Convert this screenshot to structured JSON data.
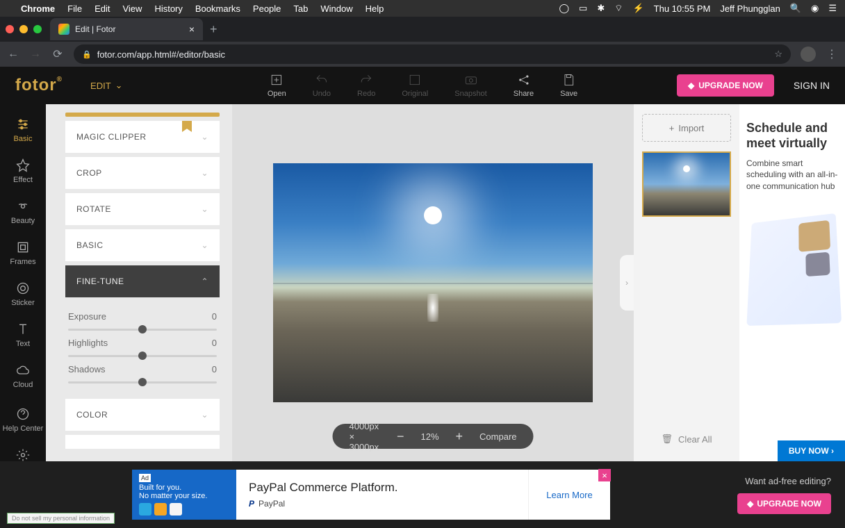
{
  "menubar": {
    "apple": "",
    "items": [
      "Chrome",
      "File",
      "Edit",
      "View",
      "History",
      "Bookmarks",
      "People",
      "Tab",
      "Window",
      "Help"
    ],
    "clock": "Thu 10:55 PM",
    "user": "Jeff Phungglan"
  },
  "browser": {
    "tab_title": "Edit | Fotor",
    "url": "fotor.com/app.html#/editor/basic"
  },
  "appbar": {
    "logo": "fotor",
    "edit_label": "EDIT",
    "tools": {
      "open": "Open",
      "undo": "Undo",
      "redo": "Redo",
      "original": "Original",
      "snapshot": "Snapshot",
      "share": "Share",
      "save": "Save"
    },
    "upgrade": "UPGRADE NOW",
    "signin": "SIGN IN"
  },
  "toolstrip": {
    "basic": "Basic",
    "effect": "Effect",
    "beauty": "Beauty",
    "frames": "Frames",
    "sticker": "Sticker",
    "text": "Text",
    "cloud": "Cloud",
    "help": "Help Center",
    "settings": "Settings"
  },
  "panel": {
    "magic_clipper": "MAGIC CLIPPER",
    "crop": "CROP",
    "rotate": "ROTATE",
    "basic": "BASIC",
    "finetune": "FINE-TUNE",
    "color": "COLOR",
    "sliders": {
      "exposure": {
        "label": "Exposure",
        "value": "0"
      },
      "highlights": {
        "label": "Highlights",
        "value": "0"
      },
      "shadows": {
        "label": "Shadows",
        "value": "0"
      }
    }
  },
  "canvas": {
    "dimensions": "4000px × 3000px",
    "zoom": "12%",
    "compare": "Compare"
  },
  "thumbs": {
    "import": "Import",
    "clear_all": "Clear All"
  },
  "ad_right": {
    "title": "Schedule and meet virtually",
    "body": "Combine smart scheduling with an all-in-one communication hub",
    "cta": "BUY NOW"
  },
  "ad_bottom": {
    "tag": "Ad",
    "line1": "Built for you.",
    "line2": "No matter your size.",
    "headline": "PayPal Commerce Platform.",
    "brand": "PayPal",
    "learn_more": "Learn More"
  },
  "footer": {
    "adfree": "Want ad-free editing?",
    "upgrade": "UPGRADE NOW",
    "privacy": "Do not sell my personal information"
  }
}
